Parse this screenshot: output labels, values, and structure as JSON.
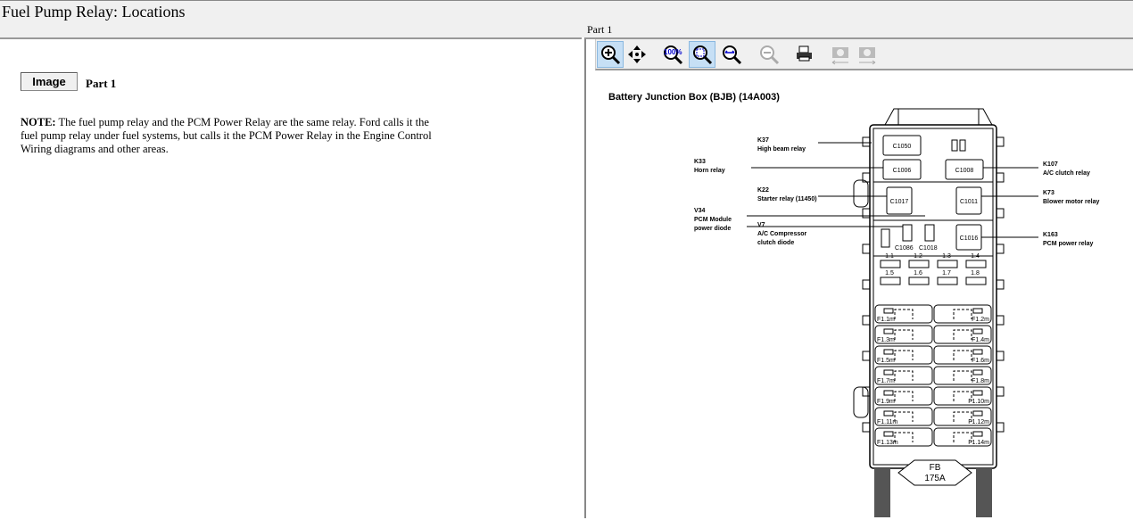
{
  "header": {
    "title": "Fuel Pump Relay:  Locations",
    "part_label": "Part 1"
  },
  "left": {
    "image_button": "Image",
    "image_part": "Part 1",
    "note_label": "NOTE:",
    "note_text": " The fuel pump relay and the PCM Power Relay are the same relay.  Ford calls it the fuel pump relay under fuel systems, but calls it the PCM Power Relay in the Engine Control Wiring diagrams and other areas."
  },
  "toolbar": [
    {
      "icon": "zoom-in-icon",
      "active": true,
      "disabled": false
    },
    {
      "icon": "pan-icon",
      "active": false,
      "disabled": false
    },
    {
      "icon": "zoom-100-icon",
      "active": false,
      "disabled": false
    },
    {
      "icon": "zoom-fit-icon",
      "active": true,
      "disabled": false
    },
    {
      "icon": "zoom-width-icon",
      "active": false,
      "disabled": false
    },
    {
      "icon": "zoom-out-icon",
      "active": false,
      "disabled": true
    },
    {
      "icon": "print-icon",
      "active": false,
      "disabled": false
    },
    {
      "icon": "previous-image-icon",
      "active": false,
      "disabled": true
    },
    {
      "icon": "next-image-icon",
      "active": false,
      "disabled": true
    }
  ],
  "diagram": {
    "title": "Battery Junction Box (BJB) (14A003)",
    "callouts": [
      {
        "id": "K37",
        "desc": [
          "High beam relay"
        ]
      },
      {
        "id": "K33",
        "desc": [
          "Horn relay"
        ]
      },
      {
        "id": "K107",
        "desc": [
          "A/C clutch relay"
        ]
      },
      {
        "id": "K22",
        "desc": [
          "Starter relay (11450)"
        ]
      },
      {
        "id": "K73",
        "desc": [
          "Blower motor relay"
        ]
      },
      {
        "id": "V34",
        "desc": [
          "PCM Module",
          "power diode"
        ]
      },
      {
        "id": "V7",
        "desc": [
          "A/C Compressor",
          "clutch diode"
        ]
      },
      {
        "id": "K163",
        "desc": [
          "PCM power relay"
        ]
      }
    ],
    "connectors": [
      "C1050",
      "C1006",
      "C1008",
      "C1017",
      "C1011",
      "C1016",
      "C1086",
      "C1018"
    ],
    "mini_fuses": [
      "1.1",
      "1.2",
      "1.3",
      "1.4",
      "1.5",
      "1.6",
      "1.7",
      "1.8"
    ],
    "maxi_fuses": [
      "F1.1m",
      "F1.2m",
      "F1.3m",
      "F1.4m",
      "F1.5m",
      "F1.6m",
      "F1.7m",
      "F1.8m",
      "F1.9m",
      "F1.10m",
      "F1.11m",
      "F1.12m",
      "F1.13m",
      "F1.14m"
    ],
    "fusible_link": [
      "FB",
      "175A"
    ]
  }
}
